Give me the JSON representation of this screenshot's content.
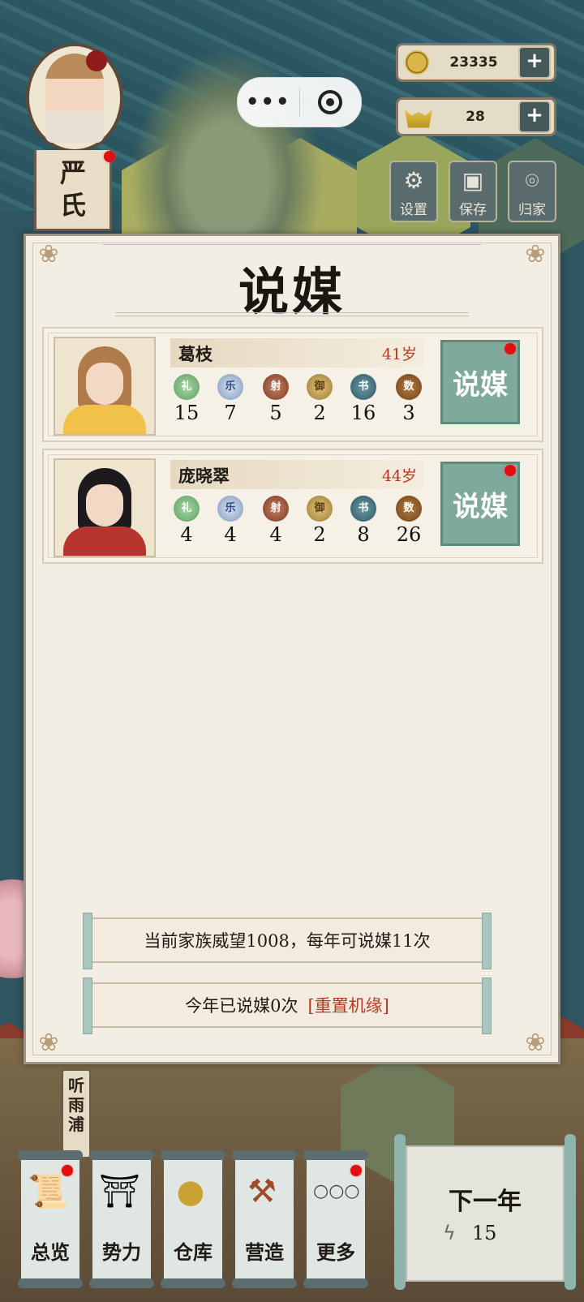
{
  "player": {
    "name_line1": "严",
    "name_line2": "氏"
  },
  "resources": {
    "coins": "23335",
    "gold": "28",
    "plus": "+"
  },
  "system_buttons": [
    {
      "label": "设置",
      "icon": "gear-icon"
    },
    {
      "label": "保存",
      "icon": "save-icon"
    },
    {
      "label": "归家",
      "icon": "location-icon"
    }
  ],
  "panel": {
    "title": "说媒",
    "match_label": "说媒",
    "candidates": [
      {
        "name": "葛枝",
        "age": "41岁",
        "stats": [
          {
            "badge": "礼",
            "value": "15"
          },
          {
            "badge": "乐",
            "value": "7"
          },
          {
            "badge": "射",
            "value": "5"
          },
          {
            "badge": "御",
            "value": "2"
          },
          {
            "badge": "书",
            "value": "16"
          },
          {
            "badge": "数",
            "value": "3"
          }
        ]
      },
      {
        "name": "庞晓翠",
        "age": "44岁",
        "stats": [
          {
            "badge": "礼",
            "value": "4"
          },
          {
            "badge": "乐",
            "value": "4"
          },
          {
            "badge": "射",
            "value": "4"
          },
          {
            "badge": "御",
            "value": "2"
          },
          {
            "badge": "书",
            "value": "8"
          },
          {
            "badge": "数",
            "value": "26"
          }
        ]
      }
    ],
    "info_line": "当前家族威望1008，每年可说媒11次",
    "used_line": "今年已说媒0次",
    "reset_link": "[重置机缘]"
  },
  "place_name": "听雨浦",
  "nav": [
    {
      "label": "总览",
      "icon": "scroll-brush-icon"
    },
    {
      "label": "势力",
      "icon": "palace-icon"
    },
    {
      "label": "仓库",
      "icon": "bag-icon"
    },
    {
      "label": "营造",
      "icon": "trowel-icon"
    },
    {
      "label": "更多",
      "icon": "more-icon"
    }
  ],
  "next_year": {
    "label": "下一年",
    "energy": "15"
  },
  "colors": {
    "accent_green": "#7fa99a",
    "age_red": "#b63a22",
    "notify_red": "#e01010"
  }
}
